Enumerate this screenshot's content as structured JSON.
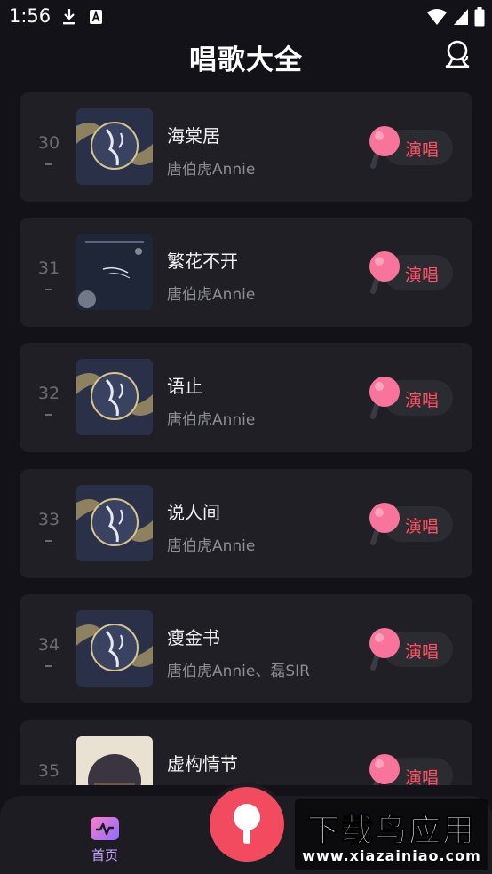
{
  "status_bar": {
    "time": "1:56",
    "left_icons": [
      "download-icon",
      "keyboard-a-icon"
    ],
    "right_icons": [
      "wifi-icon",
      "cell-signal-icon",
      "battery-icon"
    ]
  },
  "header": {
    "title": "唱歌大全",
    "action_icon": "headset-person-icon"
  },
  "songs": [
    {
      "rank": "30",
      "title": "海棠居",
      "artist": "唐伯虎Annie",
      "sing_label": "演唱",
      "cover": "moon-night-cover"
    },
    {
      "rank": "31",
      "title": "繁花不开",
      "artist": "唐伯虎Annie",
      "sing_label": "演唱",
      "cover": "blue-night-cover"
    },
    {
      "rank": "32",
      "title": "语止",
      "artist": "唐伯虎Annie",
      "sing_label": "演唱",
      "cover": "moon-night-cover"
    },
    {
      "rank": "33",
      "title": "说人间",
      "artist": "唐伯虎Annie",
      "sing_label": "演唱",
      "cover": "moon-night-cover"
    },
    {
      "rank": "34",
      "title": "瘦金书",
      "artist": "唐伯虎Annie、磊SIR",
      "sing_label": "演唱",
      "cover": "moon-night-cover"
    },
    {
      "rank": "35",
      "title": "虚构情节",
      "artist": "",
      "sing_label": "演唱",
      "cover": "city-circle-cover"
    }
  ],
  "bottom_nav": {
    "home_label": "首页",
    "center_icon": "microphone-icon"
  },
  "watermark": {
    "title": "下载鸟应用",
    "subtitle": "www.xiazainiao.com"
  },
  "colors": {
    "background": "#121218",
    "card": "#1f1f25",
    "accent": "#ff4f62",
    "mic_pink": "#f8749a"
  }
}
